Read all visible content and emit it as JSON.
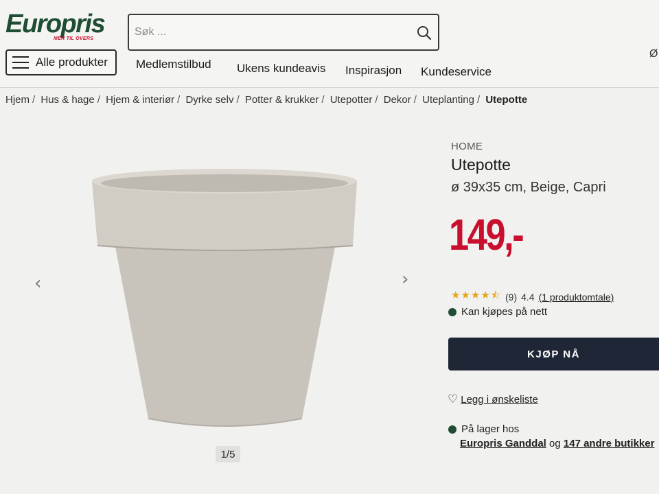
{
  "header": {
    "logo_text": "Europris",
    "logo_tagline": "MER TIL OVERS",
    "search_placeholder": "Søk ...",
    "right_edge_char": "Ø",
    "all_products_label": "Alle produkter",
    "nav": [
      "Medlemstilbud",
      "Ukens kundeavis",
      "Inspirasjon",
      "Kundeservice"
    ]
  },
  "breadcrumb": [
    "Hjem",
    "Hus & hage",
    "Hjem & interiør",
    "Dyrke selv",
    "Potter & krukker",
    "Utepotter",
    "Dekor",
    "Uteplanting",
    "Utepotte"
  ],
  "gallery": {
    "counter": "1/5"
  },
  "product": {
    "brand": "HOME",
    "title": "Utepotte",
    "subtitle": "ø 39x35 cm, Beige, Capri",
    "price": "149,-",
    "rating_stars": 4.4,
    "review_count": "(9)",
    "rating_value": "4.4",
    "reviews_link": "(1 produktomtale)",
    "availability": "Kan kjøpes på nett",
    "buy_label": "KJØP NÅ",
    "wishlist_label": "Legg i ønskeliste",
    "stock_label": "På lager hos",
    "stock_store": "Europris Ganddal",
    "stock_and": "og",
    "stock_more": "147 andre butikker"
  },
  "colors": {
    "brand_green": "#1f4d33",
    "price_red": "#c8102e",
    "buy_button": "#1f2736",
    "star": "#e6a31a",
    "pot": "#cbc6bd"
  }
}
